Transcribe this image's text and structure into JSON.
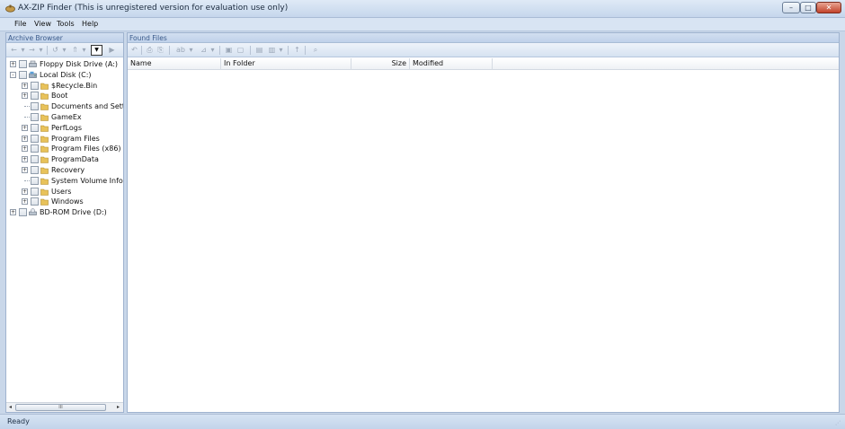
{
  "window": {
    "title": "AX-ZIP Finder (This is unregistered version for evaluation use only)",
    "controls": {
      "minimize": "–",
      "maximize": "□",
      "close": "✕"
    }
  },
  "menu": [
    "File",
    "View",
    "Tools",
    "Help"
  ],
  "left_pane": {
    "header": "Archive Browser",
    "toolbar_icons": [
      "back-arrow-icon",
      "forward-arrow-icon",
      "history-icon",
      "folder-up-icon",
      "view-dropdown-icon",
      "go-icon"
    ],
    "tree": [
      {
        "label": "Floppy Disk Drive (A:)",
        "icon": "floppy-icon",
        "level": 0,
        "expander": "+"
      },
      {
        "label": "Local Disk (C:)",
        "icon": "hard-drive-icon",
        "level": 0,
        "expander": "-"
      },
      {
        "label": "$Recycle.Bin",
        "icon": "folder-icon",
        "level": 1,
        "expander": "+"
      },
      {
        "label": "Boot",
        "icon": "folder-icon",
        "level": 1,
        "expander": "+"
      },
      {
        "label": "Documents and Setting",
        "icon": "folder-icon",
        "level": 1,
        "expander": ""
      },
      {
        "label": "GameEx",
        "icon": "folder-icon",
        "level": 1,
        "expander": ""
      },
      {
        "label": "PerfLogs",
        "icon": "folder-icon",
        "level": 1,
        "expander": "+"
      },
      {
        "label": "Program Files",
        "icon": "folder-icon",
        "level": 1,
        "expander": "+"
      },
      {
        "label": "Program Files (x86)",
        "icon": "folder-icon",
        "level": 1,
        "expander": "+"
      },
      {
        "label": "ProgramData",
        "icon": "folder-icon",
        "level": 1,
        "expander": "+"
      },
      {
        "label": "Recovery",
        "icon": "folder-icon",
        "level": 1,
        "expander": "+"
      },
      {
        "label": "System Volume Informa",
        "icon": "folder-icon",
        "level": 1,
        "expander": ""
      },
      {
        "label": "Users",
        "icon": "folder-icon",
        "level": 1,
        "expander": "+"
      },
      {
        "label": "Windows",
        "icon": "folder-icon",
        "level": 1,
        "expander": "+"
      },
      {
        "label": "BD-ROM Drive (D:)",
        "icon": "optical-drive-icon",
        "level": 0,
        "expander": "+"
      }
    ],
    "scrollbar": {
      "left": "◂",
      "thumb": "III",
      "right": "▸"
    }
  },
  "right_pane": {
    "header": "Found Files",
    "toolbar_icons": [
      "undo-icon",
      "extract-icon",
      "copy-icon",
      "find-text-icon",
      "filter-icon",
      "select-all-icon",
      "deselect-icon",
      "open-icon",
      "open-folder-icon",
      "up-icon",
      "binoculars-icon"
    ],
    "columns": [
      "Name",
      "In Folder",
      "Size",
      "Modified"
    ]
  },
  "status": {
    "text": "Ready",
    "grip": "⋰"
  },
  "colors": {
    "chrome": "#c9d7e9",
    "header_text": "#3a5a8a",
    "folder": "#e8c25a"
  }
}
